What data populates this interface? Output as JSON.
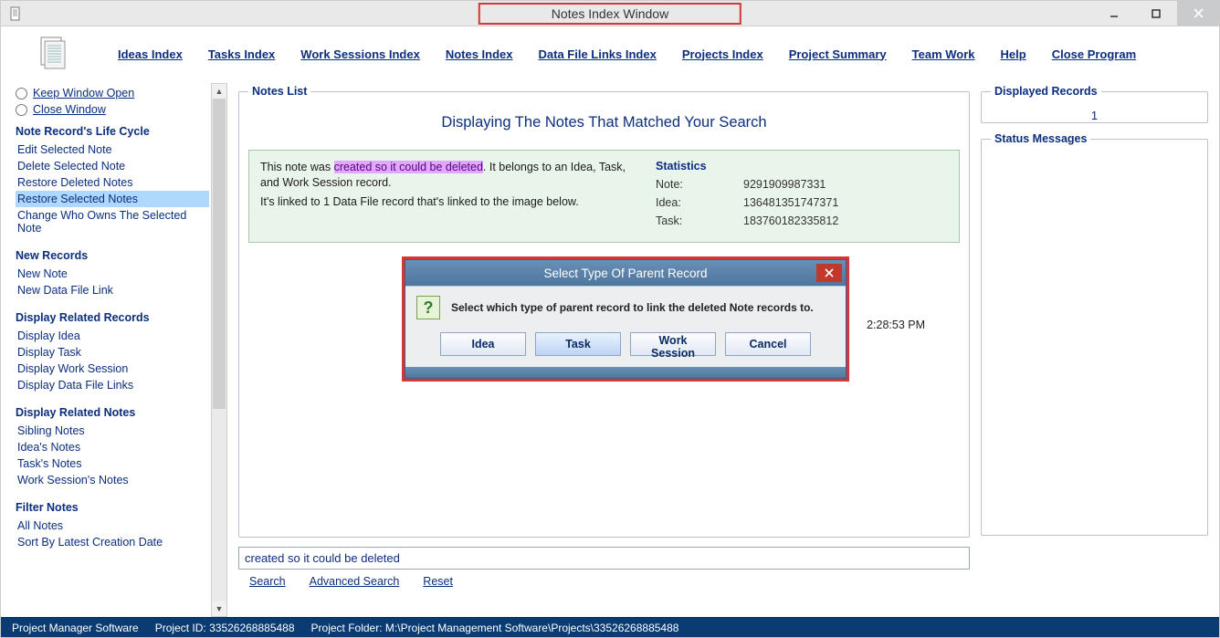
{
  "window": {
    "title": "Notes Index Window"
  },
  "topnav": {
    "items": [
      "Ideas Index",
      "Tasks Index",
      "Work Sessions Index",
      "Notes Index",
      "Data File Links Index",
      "Projects Index",
      "Project Summary",
      "Team Work",
      "Help",
      "Close Program"
    ]
  },
  "left": {
    "keep_open": "Keep Window Open",
    "close_win": "Close Window",
    "sections": {
      "life_cycle": {
        "head": "Note Record's Life Cycle",
        "items": [
          "Edit Selected Note",
          "Delete Selected Note",
          "Restore Deleted Notes",
          "Restore Selected Notes",
          "Change Who Owns The Selected Note"
        ],
        "selected_index": 3
      },
      "new_records": {
        "head": "New Records",
        "items": [
          "New Note",
          "New Data File Link"
        ]
      },
      "display_related": {
        "head": "Display Related Records",
        "items": [
          "Display Idea",
          "Display Task",
          "Display Work Session",
          "Display Data File Links"
        ]
      },
      "display_notes": {
        "head": "Display Related Notes",
        "items": [
          "Sibling Notes",
          "Idea's Notes",
          "Task's Notes",
          "Work Session's Notes"
        ]
      },
      "filter": {
        "head": "Filter Notes",
        "items": [
          "All Notes",
          "Sort By Latest Creation Date"
        ]
      }
    }
  },
  "center": {
    "legend": "Notes List",
    "title": "Displaying The Notes That Matched Your Search",
    "note": {
      "prefix": "This note was ",
      "highlight": "created so it could be deleted",
      "suffix1": ". It belongs to an Idea, Task, and Work Session record.",
      "line2": "It's linked to 1 Data File record that's linked to the image below."
    },
    "stats": {
      "head": "Statistics",
      "note_k": "Note:",
      "note_v": "9291909987331",
      "idea_k": "Idea:",
      "idea_v": "136481351747371",
      "task_k": "Task:",
      "task_v": "183760182335812"
    },
    "trailing_ts": "2:28:53 PM",
    "search_value": "created so it could be deleted",
    "search_links": {
      "search": "Search",
      "advanced": "Advanced Search",
      "reset": "Reset"
    }
  },
  "right": {
    "displayed_legend": "Displayed Records",
    "displayed_value": "1",
    "status_legend": "Status Messages"
  },
  "statusbar": {
    "app": "Project Manager Software",
    "project_id_label": "Project ID:",
    "project_id": "33526268885488",
    "folder_label": "Project Folder:",
    "folder": "M:\\Project Management Software\\Projects\\33526268885488"
  },
  "dialog": {
    "title": "Select Type Of Parent Record",
    "message": "Select which type of parent record to link the deleted Note records to.",
    "buttons": {
      "idea": "Idea",
      "task": "Task",
      "ws": "Work Session",
      "cancel": "Cancel"
    }
  }
}
